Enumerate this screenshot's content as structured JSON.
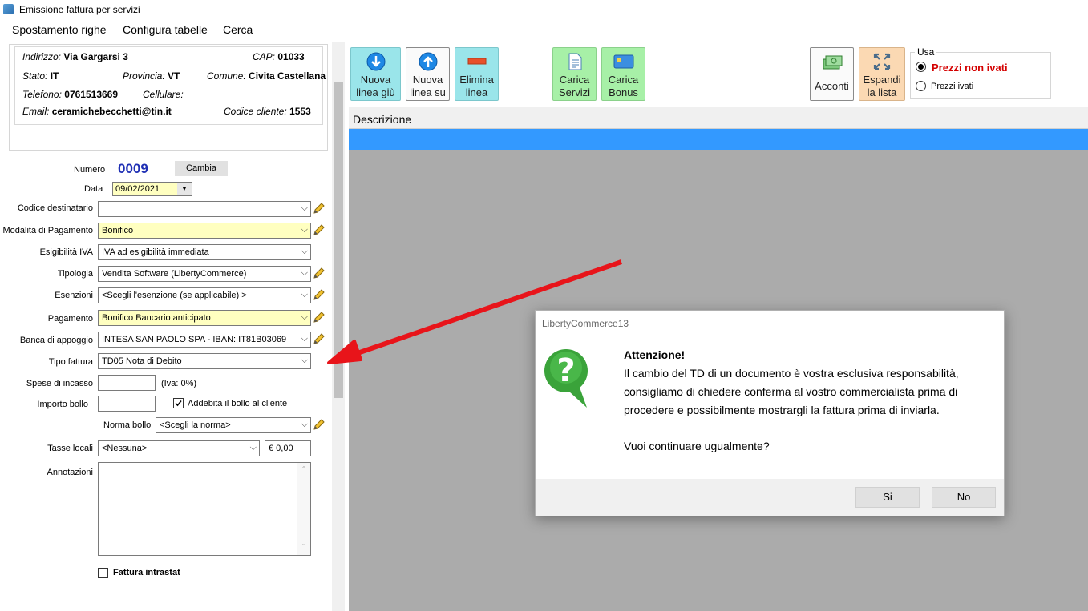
{
  "window": {
    "title": "Emissione fattura per servizi"
  },
  "menu": {
    "items": [
      "Spostamento righe",
      "Configura tabelle",
      "Cerca"
    ]
  },
  "customer": {
    "address_label": "Indirizzo:",
    "address": "Via Gargarsi 3",
    "cap_label": "CAP:",
    "cap": "01033",
    "state_label": "Stato:",
    "state": "IT",
    "province_label": "Provincia:",
    "province": "VT",
    "city_label": "Comune:",
    "city": "Civita Castellana",
    "phone_label": "Telefono:",
    "phone": "0761513669",
    "mobile_label": "Cellulare:",
    "mobile": "",
    "email_label": "Email:",
    "email": "ceramichebecchetti@tin.it",
    "code_label": "Codice cliente:",
    "code": "1553"
  },
  "form": {
    "numero_label": "Numero",
    "numero": "0009",
    "cambia_label": "Cambia",
    "data_label": "Data",
    "data": "09/02/2021",
    "codice_destinatario_label": "Codice destinatario",
    "codice_destinatario": "",
    "modalita_label": "Modalità di Pagamento",
    "modalita": "Bonifico",
    "esigibilita_label": "Esigibilità IVA",
    "esigibilita": "IVA ad esigibilità immediata",
    "tipologia_label": "Tipologia",
    "tipologia": "Vendita Software (LibertyCommerce)",
    "esenzioni_label": "Esenzioni",
    "esenzioni": "<Scegli l'esenzione (se applicabile) >",
    "pagamento_label": "Pagamento",
    "pagamento": "Bonifico Bancario anticipato",
    "banca_label": "Banca di appoggio",
    "banca": "INTESA SAN PAOLO SPA - IBAN: IT81B03069",
    "tipo_fattura_label": "Tipo fattura",
    "tipo_fattura": "TD05 Nota di Debito",
    "spese_label": "Spese di incasso",
    "spese_iva": "(Iva: 0%)",
    "bollo_label": "Importo bollo",
    "addebita_label": "Addebita il bollo al cliente",
    "addebita_checked": true,
    "norma_bollo_label": "Norma bollo",
    "norma_bollo": "<Scegli la norma>",
    "tasse_label": "Tasse locali",
    "tasse": "<Nessuna>",
    "tasse_importo": "€ 0,00",
    "annotazioni_label": "Annotazioni",
    "intrastat_label": "Fattura intrastat",
    "intrastat_checked": false
  },
  "toolbar": {
    "nuova_giu": [
      "Nuova",
      "linea giù"
    ],
    "nuova_su": [
      "Nuova",
      "linea su"
    ],
    "elimina": [
      "Elimina",
      "linea"
    ],
    "carica_servizi": [
      "Carica",
      "Servizi"
    ],
    "carica_bonus": [
      "Carica",
      "Bonus"
    ],
    "acconti": "Acconti",
    "espandi": [
      "Espandi",
      "la lista"
    ]
  },
  "usa": {
    "title": "Usa",
    "option1": "Prezzi non ivati",
    "option2": "Prezzi ivati",
    "selected": "Prezzi non ivati"
  },
  "grid": {
    "header": "Descrizione"
  },
  "dialog": {
    "title": "LibertyCommerce13",
    "heading": "Attenzione!",
    "lines": [
      "Il cambio del TD di un documento è vostra esclusiva responsabilità,",
      "consigliamo di chiedere conferma al vostro commercialista prima di",
      "procedere e possibilmente mostrargli la fattura prima di inviarla."
    ],
    "question": "Vuoi continuare ugualmente?",
    "yes": "Si",
    "no": "No"
  },
  "colors": {
    "accent": "#3399ff",
    "number": "#1f2fb4",
    "warning_text": "#d40000",
    "arrow": "#e8141a",
    "grid_bg": "#ababab"
  }
}
